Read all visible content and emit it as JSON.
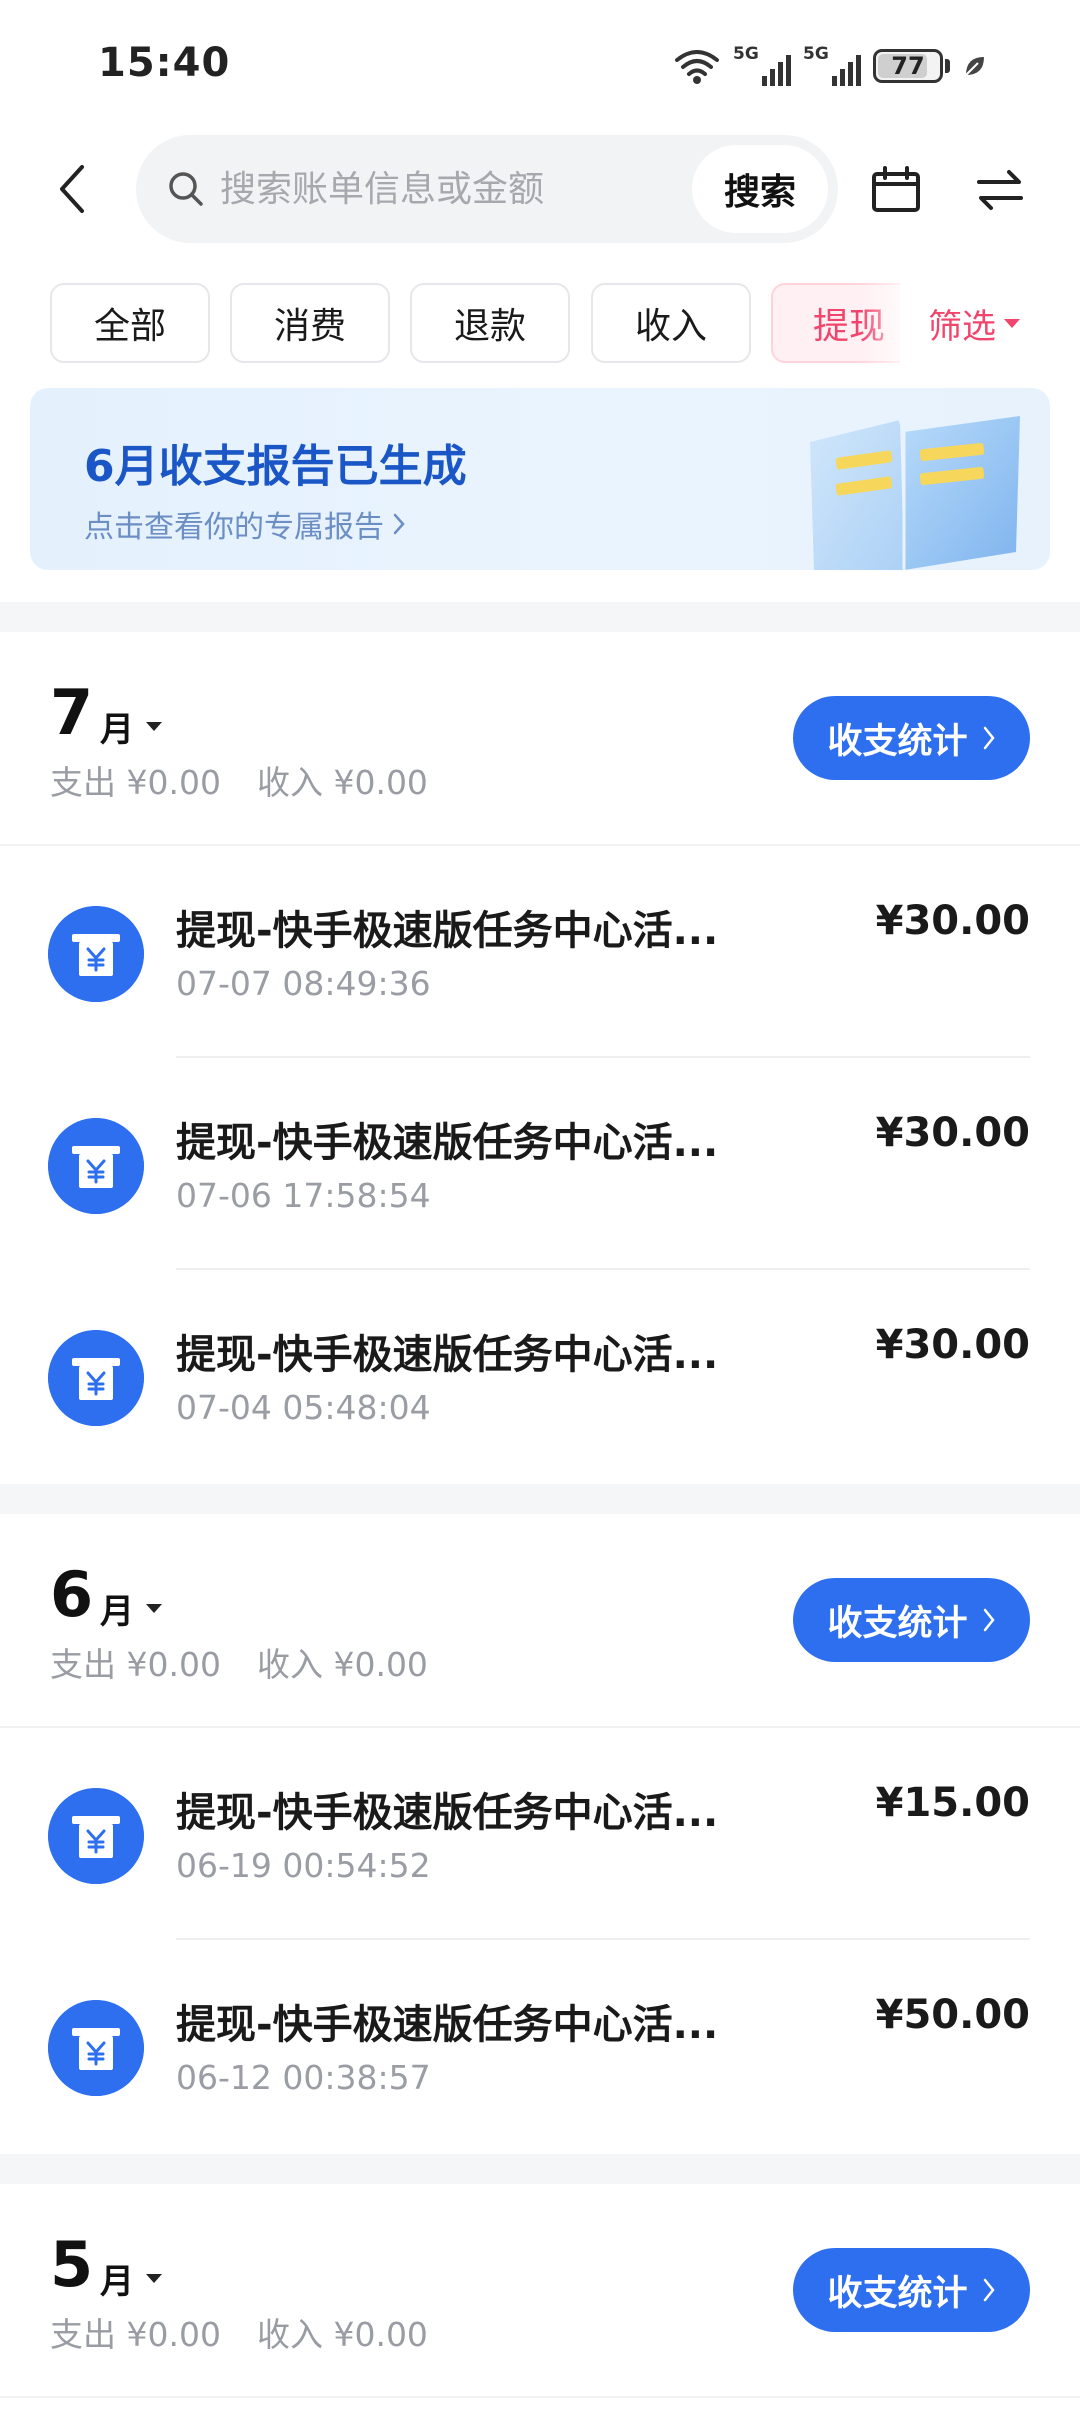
{
  "status_bar": {
    "time": "15:40",
    "battery": "77",
    "network_1": "5G",
    "network_2": "5G"
  },
  "header": {
    "search_placeholder": "搜索账单信息或金额",
    "search_button": "搜索"
  },
  "filters": {
    "chips": [
      "全部",
      "消费",
      "退款",
      "收入",
      "提现"
    ],
    "active_chip": "提现",
    "filter_label": "筛选"
  },
  "banner": {
    "title": "6月收支报告已生成",
    "subtitle": "点击查看你的专属报告"
  },
  "months": [
    {
      "month": "7",
      "unit": "月",
      "expense": "支出 ¥0.00",
      "income": "收入 ¥0.00",
      "stats_label": "收支统计",
      "transactions": [
        {
          "title": "提现-快手极速版任务中心活...",
          "time": "07-07 08:49:36",
          "amount": "¥30.00"
        },
        {
          "title": "提现-快手极速版任务中心活...",
          "time": "07-06 17:58:54",
          "amount": "¥30.00"
        },
        {
          "title": "提现-快手极速版任务中心活...",
          "time": "07-04 05:48:04",
          "amount": "¥30.00"
        }
      ]
    },
    {
      "month": "6",
      "unit": "月",
      "expense": "支出 ¥0.00",
      "income": "收入 ¥0.00",
      "stats_label": "收支统计",
      "transactions": [
        {
          "title": "提现-快手极速版任务中心活...",
          "time": "06-19 00:54:52",
          "amount": "¥15.00"
        },
        {
          "title": "提现-快手极速版任务中心活...",
          "time": "06-12 00:38:57",
          "amount": "¥50.00"
        }
      ]
    },
    {
      "month": "5",
      "unit": "月",
      "expense": "支出 ¥0.00",
      "income": "收入 ¥0.00",
      "stats_label": "收支统计",
      "transactions": []
    }
  ],
  "colors": {
    "accent_blue": "#2e6ff0",
    "filter_pink": "#f0456d",
    "banner_title": "#1b56c6"
  },
  "icons": {
    "back": "chevron-left-icon",
    "search": "search-icon",
    "calendar": "calendar-icon",
    "switch": "swap-arrows-icon",
    "transaction": "withdraw-yuan-icon"
  }
}
